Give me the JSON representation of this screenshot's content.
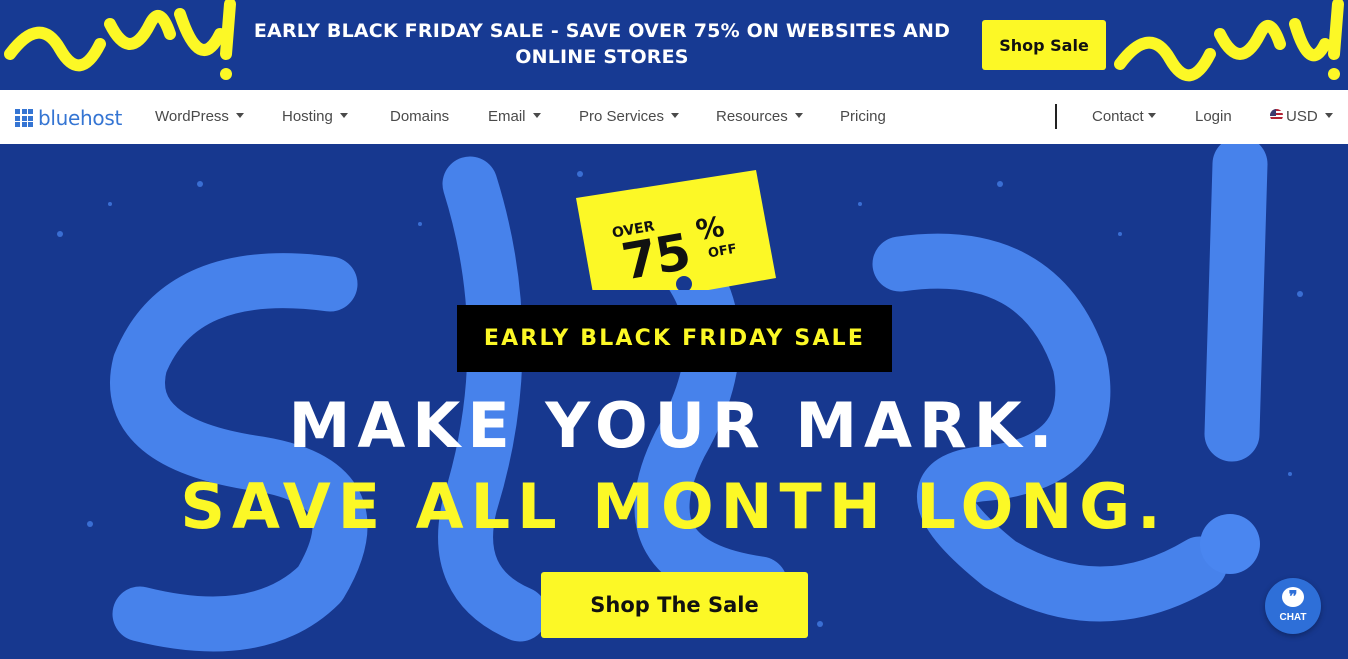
{
  "promo": {
    "text_prefix": "EARLY BLACK FRIDAY SALE - ",
    "text_bold": "SAVE OVER 75%",
    "text_suffix": " ON WEBSITES AND ONLINE STORES",
    "button_label": "Shop Sale",
    "graffiti_text": "sale!"
  },
  "nav": {
    "logo_text": "bluehost",
    "items": [
      {
        "label": "WordPress",
        "has_dropdown": true
      },
      {
        "label": "Hosting",
        "has_dropdown": true
      },
      {
        "label": "Domains",
        "has_dropdown": false
      },
      {
        "label": "Email",
        "has_dropdown": true
      },
      {
        "label": "Pro Services",
        "has_dropdown": true
      },
      {
        "label": "Resources",
        "has_dropdown": true
      },
      {
        "label": "Pricing",
        "has_dropdown": false
      }
    ],
    "contact_label": "Contact",
    "login_label": "Login",
    "currency_label": "USD"
  },
  "hero": {
    "ticket_over": "OVER",
    "ticket_number": "75",
    "ticket_percent": "%",
    "ticket_off": "OFF",
    "eyebrow": "EARLY BLACK FRIDAY SALE",
    "headline_line1": "MAKE YOUR MARK.",
    "headline_line2": "SAVE ALL MONTH LONG.",
    "cta_label": "Shop The Sale"
  },
  "chat": {
    "label": "CHAT",
    "bubble_glyph": "❞"
  },
  "colors": {
    "brand_blue": "#3575d3",
    "hero_navy": "#17388f",
    "accent_yellow": "#fcf826",
    "graffiti_blue": "#4a86f0"
  }
}
